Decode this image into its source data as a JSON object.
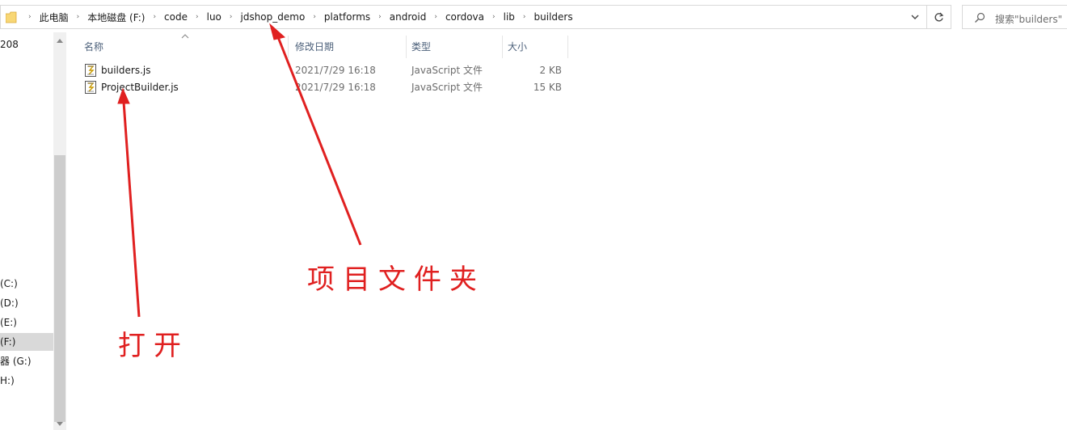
{
  "address_bar": {
    "breadcrumbs": [
      "此电脑",
      "本地磁盘 (F:)",
      "code",
      "luo",
      "jdshop_demo",
      "platforms",
      "android",
      "cordova",
      "lib",
      "builders"
    ]
  },
  "search": {
    "placeholder": "搜索\"builders\""
  },
  "nav_pane": {
    "items": [
      {
        "label": "208",
        "selected": false
      },
      {
        "label": "(C:)",
        "selected": false
      },
      {
        "label": "(D:)",
        "selected": false
      },
      {
        "label": "(E:)",
        "selected": false
      },
      {
        "label": "(F:)",
        "selected": true
      },
      {
        "label": "器 (G:)",
        "selected": false
      },
      {
        "label": "H:)",
        "selected": false
      }
    ]
  },
  "columns": {
    "name": "名称",
    "date": "修改日期",
    "type": "类型",
    "size": "大小"
  },
  "files": [
    {
      "name": "builders.js",
      "date": "2021/7/29 16:18",
      "type": "JavaScript 文件",
      "size": "2 KB"
    },
    {
      "name": "ProjectBuilder.js",
      "date": "2021/7/29 16:18",
      "type": "JavaScript 文件",
      "size": "15 KB"
    }
  ],
  "annotations": {
    "project_folder": "项目文件夹",
    "open": "打开"
  },
  "colors": {
    "annotation": "#e02020",
    "selection": "#d9d9d9",
    "column_header": "#4c607a"
  }
}
